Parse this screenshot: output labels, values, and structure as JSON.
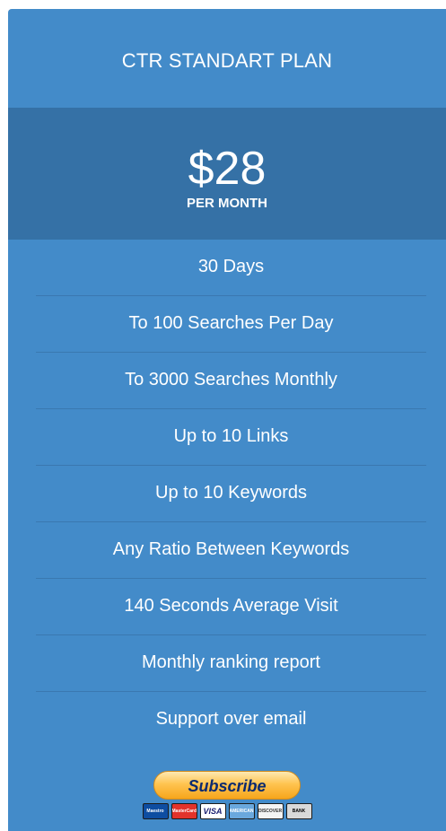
{
  "plan": {
    "title": "CTR STANDART PLAN",
    "price": "$28",
    "period": "PER MONTH"
  },
  "features": [
    "30 Days",
    "To 100 Searches Per Day",
    "To 3000 Searches Monthly",
    "Up to 10 Links",
    "Up to 10 Keywords",
    "Any Ratio Between Keywords",
    "140 Seconds Average Visit",
    "Monthly ranking report",
    "Support over email"
  ],
  "subscribe": {
    "label": "Subscribe"
  },
  "payment_logos": [
    {
      "name": "maestro-logo",
      "text": "Maestro"
    },
    {
      "name": "mastercard-logo",
      "text": "MasterCard"
    },
    {
      "name": "visa-logo",
      "text": "VISA"
    },
    {
      "name": "amex-logo",
      "text": "AMERICAN EXPRESS"
    },
    {
      "name": "discover-logo",
      "text": "DISCOVER"
    },
    {
      "name": "bank-logo",
      "text": "BANK"
    }
  ],
  "colors": {
    "card_bg": "#438bc9",
    "price_band_bg": "#3571a6",
    "text": "#ffffff",
    "button_gold": "#ffc450"
  }
}
